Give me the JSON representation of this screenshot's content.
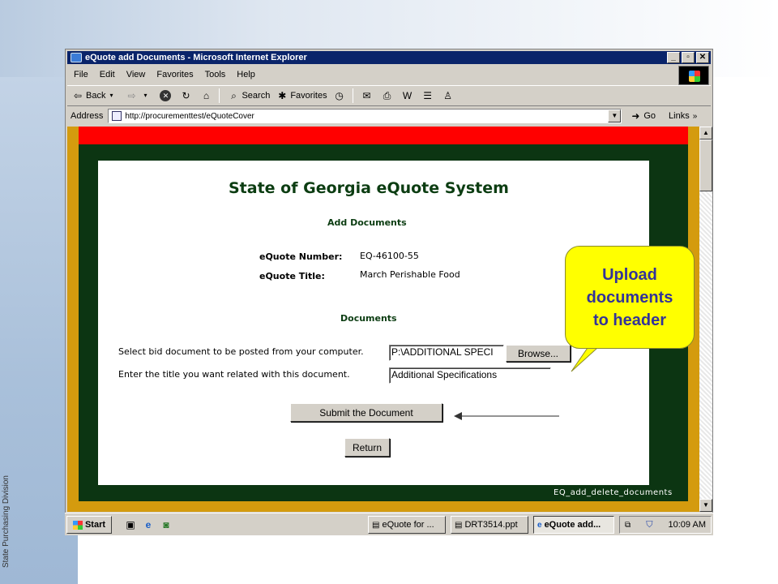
{
  "slide": {
    "side_label": "State Purchasing Division",
    "callout": [
      "Upload",
      "documents",
      "to header"
    ]
  },
  "window": {
    "title": "eQuote add Documents - Microsoft Internet Explorer",
    "menu": [
      "File",
      "Edit",
      "View",
      "Favorites",
      "Tools",
      "Help"
    ],
    "toolbar": {
      "back": "Back",
      "search": "Search",
      "favorites": "Favorites"
    },
    "address": {
      "label": "Address",
      "url": "http://procurementtest/eQuoteCover",
      "go": "Go",
      "links": "Links"
    }
  },
  "page": {
    "title": "State of Georgia eQuote System",
    "subtitle": "Add Documents",
    "number_label": "eQuote Number:",
    "number_value": "EQ-46100-55",
    "title_label": "eQuote Title:",
    "title_value": "March Perishable Food",
    "documents_heading": "Documents",
    "select_prompt": "Select bid document to be posted from your computer.",
    "file_value": "P:\\ADDITIONAL SPECI",
    "browse_label": "Browse...",
    "title_prompt": "Enter the title you want related with this document.",
    "doc_title_value": "Additional Specifications",
    "submit_label": "Submit the Document",
    "return_label": "Return",
    "footer": "EQ_add_delete_documents"
  },
  "taskbar": {
    "start": "Start",
    "tasks": [
      "eQuote for ...",
      "DRT3514.ppt",
      "eQuote add..."
    ],
    "clock": "10:09 AM"
  },
  "colors": {
    "page_border": "#d49b0e",
    "header_band": "#ff0000",
    "panel": "#0c3512",
    "callout": "#ffff00",
    "callout_text": "#333399"
  }
}
